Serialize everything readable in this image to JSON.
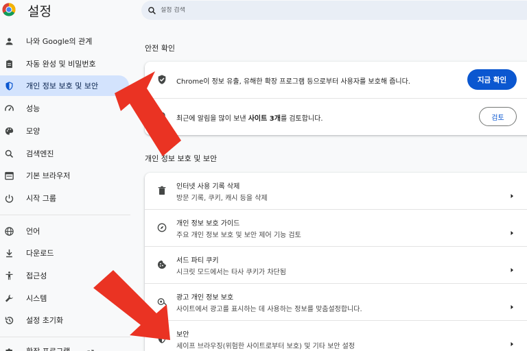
{
  "header": {
    "title": "설정",
    "search_placeholder": "설정 검색",
    "logo_icon": "chrome-logo-icon"
  },
  "sidebar": {
    "items": [
      {
        "label": "나와 Google의 관계",
        "icon": "person-icon"
      },
      {
        "label": "자동 완성 및 비밀번호",
        "icon": "clipboard-icon"
      },
      {
        "label": "개인 정보 보호 및 보안",
        "icon": "shield-icon",
        "active": true
      },
      {
        "label": "성능",
        "icon": "speedometer-icon"
      },
      {
        "label": "모양",
        "icon": "palette-icon"
      },
      {
        "label": "검색엔진",
        "icon": "search-icon"
      },
      {
        "label": "기본 브라우저",
        "icon": "browser-icon"
      },
      {
        "label": "시작 그룹",
        "icon": "power-icon"
      },
      {
        "label": "언어",
        "icon": "globe-icon"
      },
      {
        "label": "다운로드",
        "icon": "download-icon"
      },
      {
        "label": "접근성",
        "icon": "accessibility-icon"
      },
      {
        "label": "시스템",
        "icon": "wrench-icon"
      },
      {
        "label": "설정 초기화",
        "icon": "history-icon"
      },
      {
        "label": "확장 프로그램",
        "icon": "puzzle-icon"
      }
    ]
  },
  "safety": {
    "heading": "안전 확인",
    "rows": [
      {
        "text": "Chrome이 정보 유출, 유해한 확장 프로그램 등으로부터 사용자를 보호해 줍니다.",
        "button": "지금 확인",
        "icon": "shield-check-icon"
      },
      {
        "text_prefix": "최근에 알림을 많이 보낸 ",
        "text_bold": "사이트 3개",
        "text_suffix": "를 검토합니다.",
        "button": "검토",
        "icon": "bell-icon"
      }
    ]
  },
  "privacy": {
    "heading": "개인 정보 보호 및 보안",
    "rows": [
      {
        "title": "인터넷 사용 기록 삭제",
        "subtitle": "방문 기록, 쿠키, 캐시 등을 삭제",
        "icon": "trash-icon"
      },
      {
        "title": "개인 정보 보호 가이드",
        "subtitle": "주요 개인 정보 보호 및 보안 제어 기능 검토",
        "icon": "compass-icon"
      },
      {
        "title": "서드 파티 쿠키",
        "subtitle": "시크릿 모드에서는 타사 쿠키가 차단됨",
        "icon": "cookie-icon"
      },
      {
        "title": "광고 개인 정보 보호",
        "subtitle": "사이트에서 광고를 표시하는 데 사용하는 정보를 맞춤설정합니다.",
        "icon": "ads-privacy-icon"
      },
      {
        "title": "보안",
        "subtitle": "세이프 브라우징(위험한 사이트로부터 보호) 및 기타 보안 설정",
        "icon": "shield-icon"
      }
    ]
  },
  "colors": {
    "accent": "#0b57d0",
    "active_nav_bg": "#d3e3fd",
    "annotation_arrow": "#ea3323",
    "page_bg": "#f8f9fa"
  }
}
